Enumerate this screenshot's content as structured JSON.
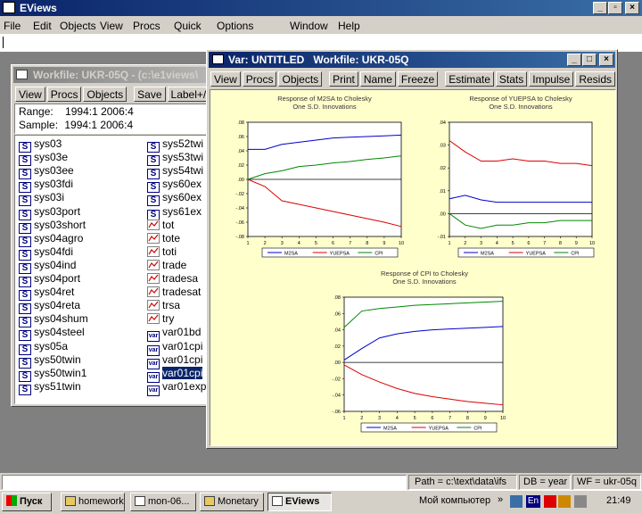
{
  "app": {
    "title": "EViews",
    "menu": [
      "File",
      "Edit",
      "Objects",
      "View",
      "Procs",
      "Quick",
      "Options",
      "Window",
      "Help"
    ]
  },
  "workfile": {
    "title": "Workfile: UKR-05Q - (c:\\e1views\\",
    "toolbar": [
      "View",
      "Procs",
      "Objects",
      "Save",
      "Label+/-",
      "Sh"
    ],
    "range_label": "Range:",
    "range_value": "1994:1 2006:4",
    "sample_label": "Sample:",
    "sample_value": "1994:1 2006:4",
    "col1": [
      {
        "icon": "S",
        "name": "sys03"
      },
      {
        "icon": "S",
        "name": "sys03e"
      },
      {
        "icon": "S",
        "name": "sys03ee"
      },
      {
        "icon": "S",
        "name": "sys03fdi"
      },
      {
        "icon": "S",
        "name": "sys03i"
      },
      {
        "icon": "S",
        "name": "sys03port"
      },
      {
        "icon": "S",
        "name": "sys03short"
      },
      {
        "icon": "S",
        "name": "sys04agro"
      },
      {
        "icon": "S",
        "name": "sys04fdi"
      },
      {
        "icon": "S",
        "name": "sys04ind"
      },
      {
        "icon": "S",
        "name": "sys04port"
      },
      {
        "icon": "S",
        "name": "sys04ret"
      },
      {
        "icon": "S",
        "name": "sys04reta"
      },
      {
        "icon": "S",
        "name": "sys04shum"
      },
      {
        "icon": "S",
        "name": "sys04steel"
      },
      {
        "icon": "S",
        "name": "sys05a"
      },
      {
        "icon": "S",
        "name": "sys50twin"
      },
      {
        "icon": "S",
        "name": "sys50twin1"
      },
      {
        "icon": "S",
        "name": "sys51twin"
      }
    ],
    "col2": [
      {
        "icon": "S",
        "name": "sys52twi"
      },
      {
        "icon": "S",
        "name": "sys53twi"
      },
      {
        "icon": "S",
        "name": "sys54twi"
      },
      {
        "icon": "S",
        "name": "sys60ex"
      },
      {
        "icon": "S",
        "name": "sys60ex"
      },
      {
        "icon": "S",
        "name": "sys61ex"
      },
      {
        "icon": "L",
        "name": "tot"
      },
      {
        "icon": "L",
        "name": "tote"
      },
      {
        "icon": "L",
        "name": "toti"
      },
      {
        "icon": "L",
        "name": "trade"
      },
      {
        "icon": "L",
        "name": "tradesa"
      },
      {
        "icon": "L",
        "name": "tradesat"
      },
      {
        "icon": "L",
        "name": "trsa"
      },
      {
        "icon": "L",
        "name": "try"
      },
      {
        "icon": "V",
        "name": "var01bd"
      },
      {
        "icon": "V",
        "name": "var01cpi"
      },
      {
        "icon": "V",
        "name": "var01cpi"
      },
      {
        "icon": "V",
        "name": "var01cpi",
        "selected": true
      },
      {
        "icon": "V",
        "name": "var01exp"
      }
    ],
    "icon_labels": {
      "S": "S",
      "V": "var"
    }
  },
  "var_window": {
    "title": "Var: UNTITLED   Workfile: UKR-05Q",
    "toolbar": [
      "View",
      "Procs",
      "Objects",
      "Print",
      "Name",
      "Freeze",
      "Estimate",
      "Stats",
      "Impulse",
      "Resids"
    ]
  },
  "status": {
    "path": "Path = c:\\text\\data\\ifs",
    "db": "DB = year",
    "wf": "WF = ukr-05q"
  },
  "taskbar": {
    "start": "Пуск",
    "buttons": [
      "homework",
      "mon-06...",
      "Monetary",
      "EViews"
    ],
    "my_computer": "Мой компьютер",
    "lang": "En",
    "clock": "21:49"
  },
  "colors": {
    "m2sa": "#0000cc",
    "yuepsa": "#dd0000",
    "cpi": "#008800",
    "plot_bg": "#ffffcc",
    "zero": "#000000"
  },
  "chart_data": [
    {
      "type": "line",
      "title": "Response of M2SA to Cholesky",
      "subtitle": "One S.D. Innovations",
      "x": [
        1,
        2,
        3,
        4,
        5,
        6,
        7,
        8,
        9,
        10
      ],
      "ylim": [
        -0.08,
        0.08
      ],
      "yticks": [
        ".08",
        ".06",
        ".04",
        ".02",
        ".00",
        "-.02",
        "-.04",
        "-.06",
        "-.08"
      ],
      "series": [
        {
          "name": "M2SA",
          "values": [
            0.042,
            0.042,
            0.049,
            0.052,
            0.055,
            0.058,
            0.059,
            0.06,
            0.061,
            0.062
          ]
        },
        {
          "name": "YUEPSA",
          "values": [
            0.0,
            -0.01,
            -0.03,
            -0.035,
            -0.04,
            -0.045,
            -0.05,
            -0.055,
            -0.06,
            -0.066
          ]
        },
        {
          "name": "CPI",
          "values": [
            0.0,
            0.008,
            0.012,
            0.018,
            0.02,
            0.023,
            0.025,
            0.028,
            0.03,
            0.033
          ]
        }
      ]
    },
    {
      "type": "line",
      "title": "Response of YUEPSA to Cholesky",
      "subtitle": "One S.D. Innovations",
      "x": [
        1,
        2,
        3,
        4,
        5,
        6,
        7,
        8,
        9,
        10
      ],
      "ylim": [
        -0.01,
        0.04
      ],
      "yticks": [
        ".04",
        ".03",
        ".02",
        ".01",
        ".00",
        "-.01"
      ],
      "series": [
        {
          "name": "M2SA",
          "values": [
            0.0065,
            0.008,
            0.006,
            0.005,
            0.005,
            0.005,
            0.005,
            0.005,
            0.005,
            0.005
          ]
        },
        {
          "name": "YUEPSA",
          "values": [
            0.032,
            0.027,
            0.023,
            0.023,
            0.024,
            0.023,
            0.023,
            0.022,
            0.022,
            0.021
          ]
        },
        {
          "name": "CPI",
          "values": [
            0.0,
            -0.005,
            -0.0065,
            -0.005,
            -0.005,
            -0.004,
            -0.004,
            -0.003,
            -0.003,
            -0.003
          ]
        }
      ]
    },
    {
      "type": "line",
      "title": "Response of CPI to Cholesky",
      "subtitle": "One S.D. Innovations",
      "x": [
        1,
        2,
        3,
        4,
        5,
        6,
        7,
        8,
        9,
        10
      ],
      "ylim": [
        -0.06,
        0.08
      ],
      "yticks": [
        ".08",
        ".06",
        ".04",
        ".02",
        ".00",
        "-.02",
        "-.04",
        "-.06"
      ],
      "series": [
        {
          "name": "M2SA",
          "values": [
            0.003,
            0.017,
            0.03,
            0.035,
            0.038,
            0.04,
            0.041,
            0.042,
            0.043,
            0.044
          ]
        },
        {
          "name": "YUEPSA",
          "values": [
            -0.003,
            -0.015,
            -0.024,
            -0.032,
            -0.038,
            -0.042,
            -0.045,
            -0.048,
            -0.05,
            -0.052
          ]
        },
        {
          "name": "CPI",
          "values": [
            0.043,
            0.063,
            0.066,
            0.068,
            0.07,
            0.071,
            0.072,
            0.073,
            0.074,
            0.075
          ]
        }
      ]
    }
  ]
}
